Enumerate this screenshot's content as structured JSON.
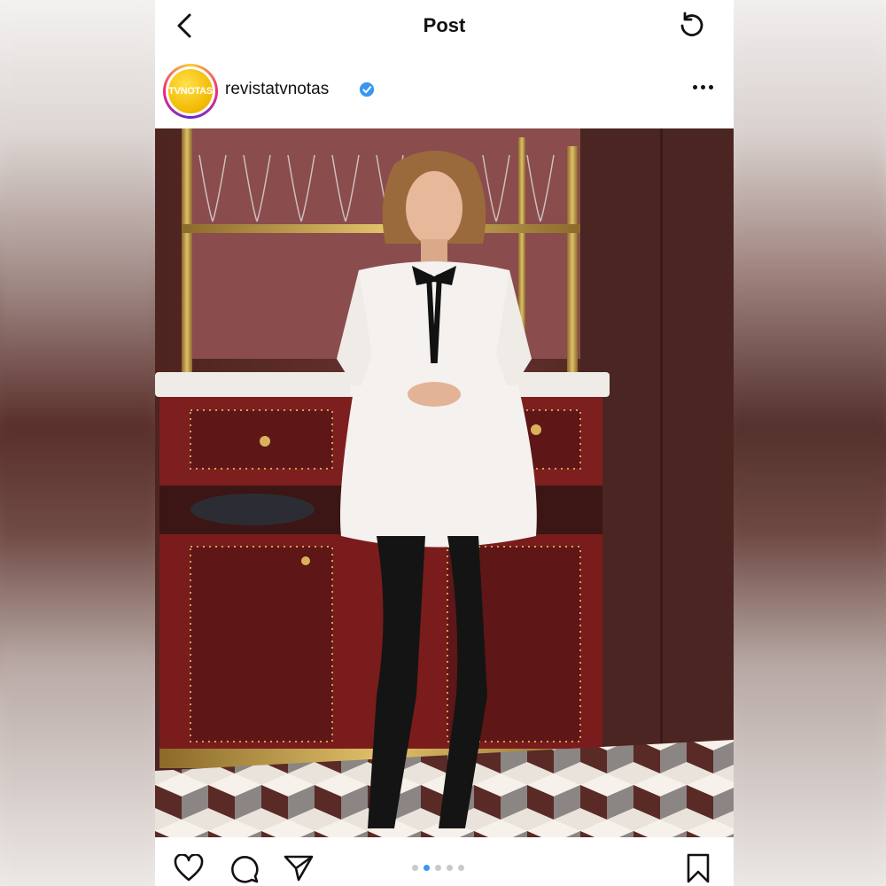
{
  "header": {
    "title": "Post",
    "back_icon": "chevron-left-icon",
    "refresh_icon": "refresh-icon"
  },
  "post": {
    "username": "revistatvnotas",
    "verified": true,
    "avatar_text": "TVNOTAS",
    "more_icon": "more-horizontal-icon"
  },
  "carousel": {
    "count": 5,
    "active_index": 1
  },
  "actions": {
    "like_icon": "heart-icon",
    "comment_icon": "comment-icon",
    "share_icon": "send-icon",
    "save_icon": "bookmark-icon"
  },
  "colors": {
    "accent": "#3897f0",
    "verified": "#3897f0"
  }
}
